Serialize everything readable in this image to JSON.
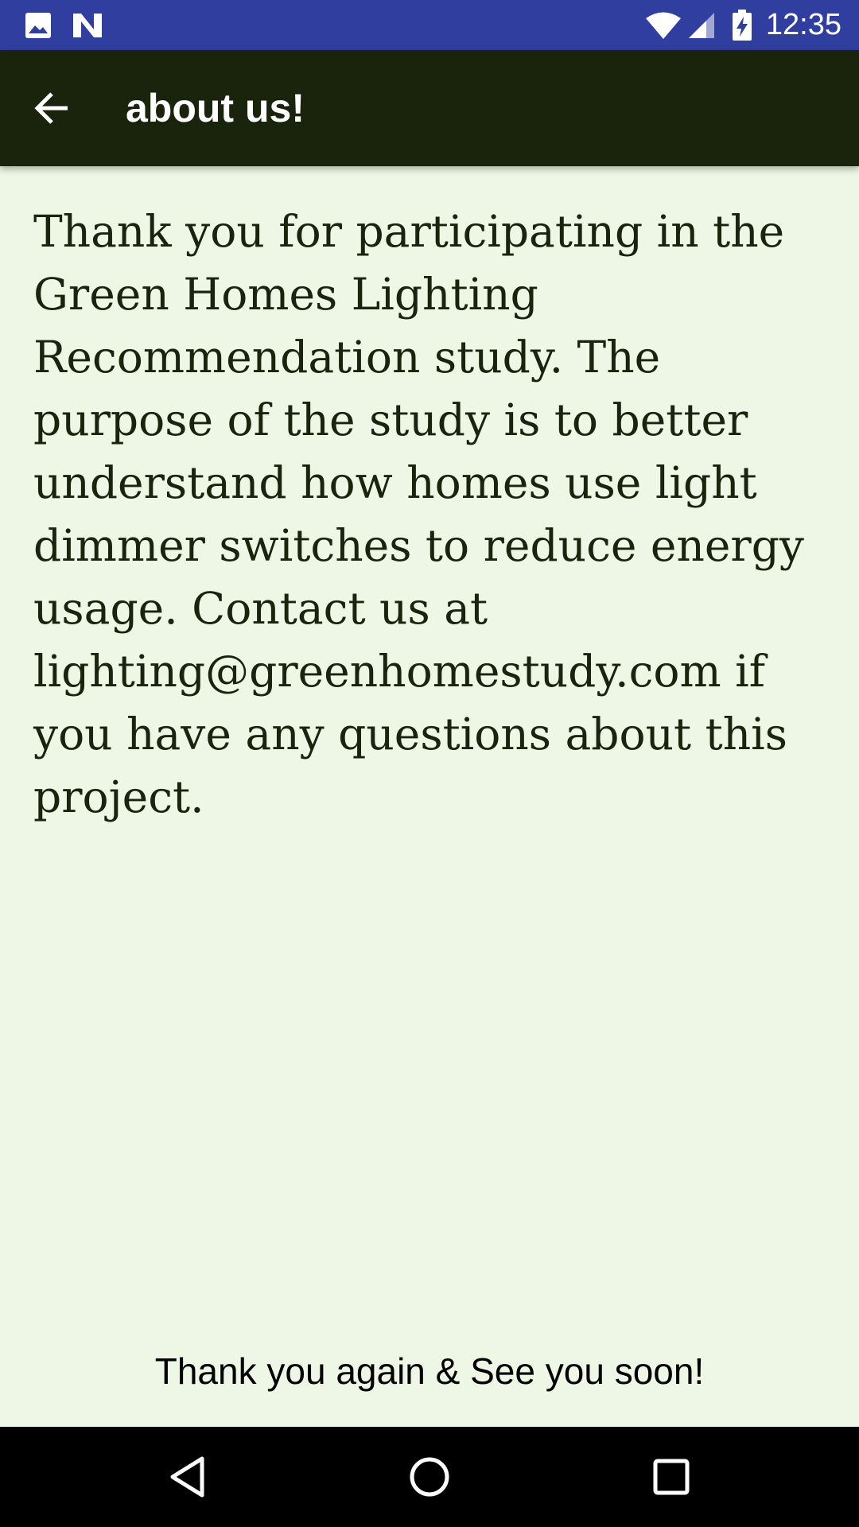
{
  "status_bar": {
    "time": "12:35",
    "icons": [
      "image-icon",
      "n-notification-icon",
      "wifi-icon",
      "cell-signal-icon",
      "battery-charging-icon"
    ]
  },
  "app_bar": {
    "title": "about us!",
    "back_icon": "arrow-back-icon"
  },
  "content": {
    "body": "Thank you for participating in the Green Homes Lighting Recommendation study. The purpose of the study is to better understand how homes use light dimmer switches to reduce energy usage. Contact us at lighting@greenhomestudy.com if you have any questions about this project."
  },
  "footer": {
    "text": "Thank you again & See you soon!"
  },
  "nav_bar": {
    "icons": [
      "back-triangle-icon",
      "home-circle-icon",
      "recents-square-icon"
    ]
  },
  "colors": {
    "status_bar": "#303f9f",
    "app_bar": "#1a230b",
    "background": "#eef6e6",
    "body_text": "#1b230f"
  }
}
